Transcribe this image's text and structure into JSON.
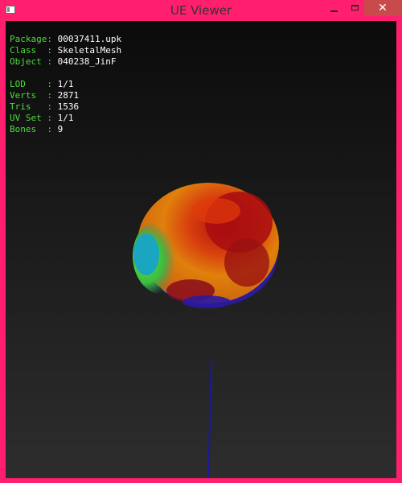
{
  "window": {
    "title": "UE Viewer",
    "close_glyph": "✕"
  },
  "info_group1": [
    {
      "label": "Package:",
      "value": "00037411.upk"
    },
    {
      "label": "Class  :",
      "value": "SkeletalMesh"
    },
    {
      "label": "Object :",
      "value": "040238_JinF"
    }
  ],
  "info_group2": [
    {
      "label": "LOD    :",
      "value": "1/1"
    },
    {
      "label": "Verts  :",
      "value": "2871"
    },
    {
      "label": "Tris   :",
      "value": "1536"
    },
    {
      "label": "UV Set :",
      "value": "1/1"
    },
    {
      "label": "Bones  :",
      "value": "9"
    }
  ],
  "colors": {
    "label": "#4cdc3c",
    "value": "#ffffff",
    "frame": "#ff1f6e",
    "axis": "#1a1aa0"
  }
}
